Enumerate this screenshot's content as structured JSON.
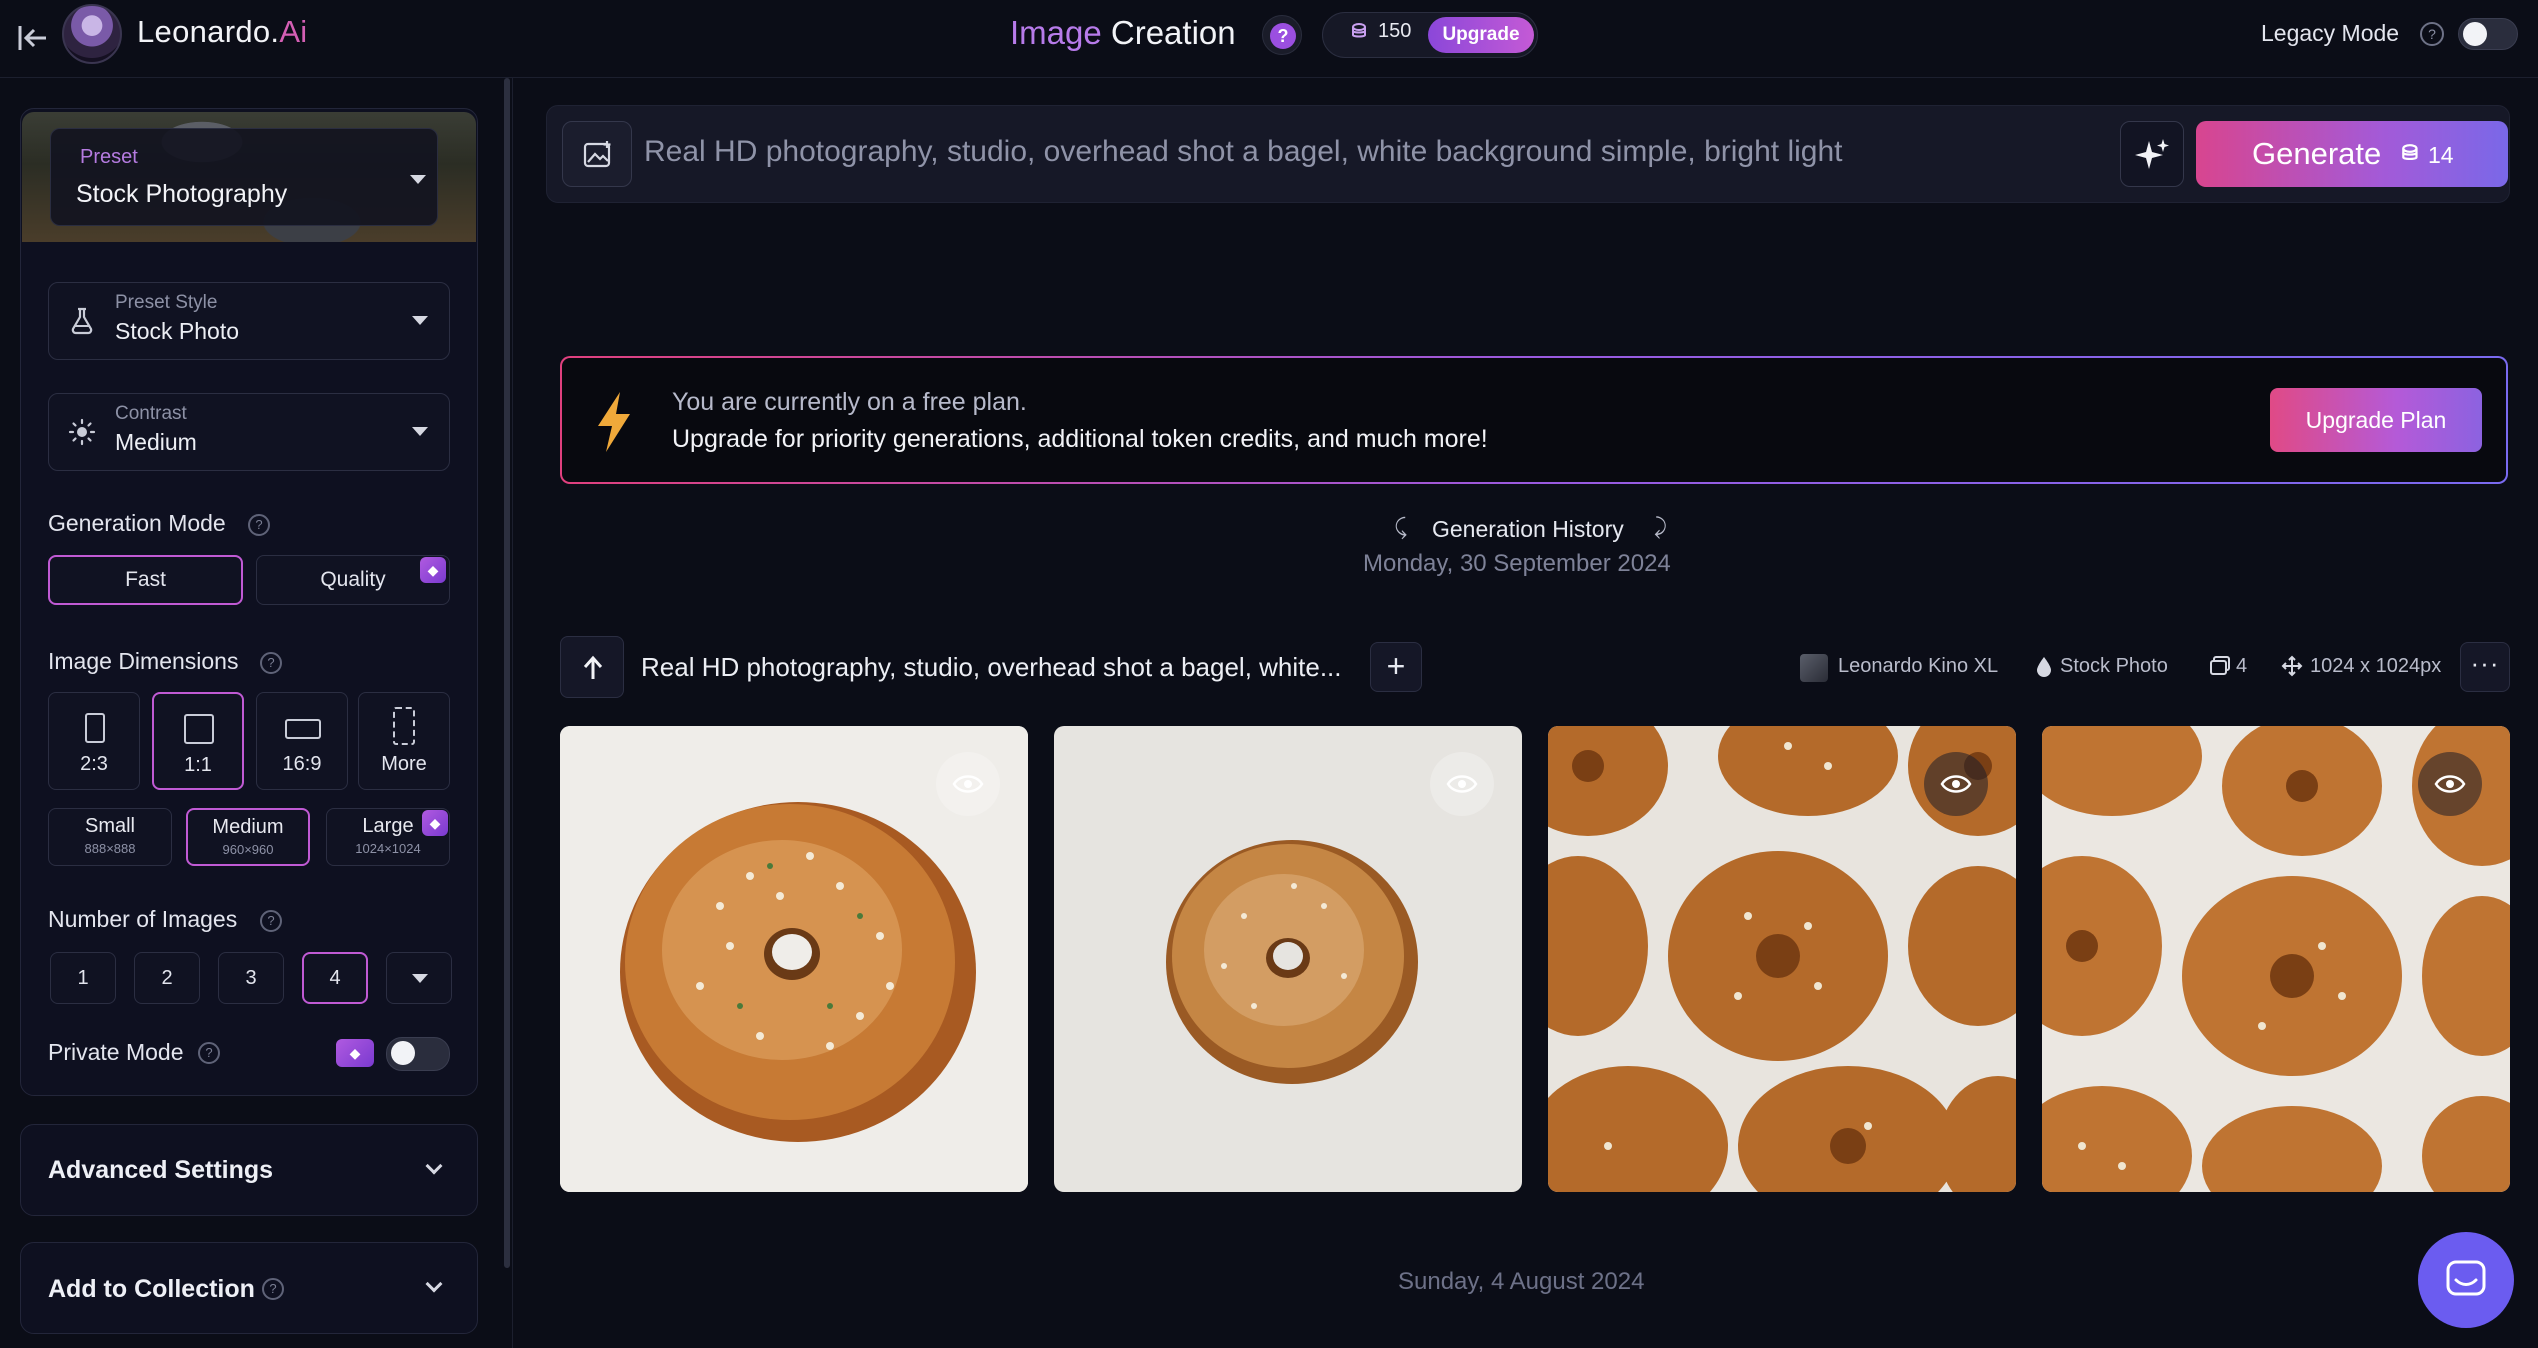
{
  "header": {
    "brand_name": "Leonardo.",
    "brand_suffix": "Ai",
    "title_highlight": "Image",
    "title_rest": " Creation",
    "help_symbol": "?",
    "tokens": "150",
    "upgrade_label": "Upgrade",
    "legacy_mode_label": "Legacy Mode",
    "legacy_help_symbol": "?"
  },
  "sidebar": {
    "preset": {
      "label": "Preset",
      "value": "Stock Photography"
    },
    "preset_style": {
      "label": "Preset Style",
      "value": "Stock Photo"
    },
    "contrast": {
      "label": "Contrast",
      "value": "Medium"
    },
    "generation_mode": {
      "label": "Generation Mode",
      "options": [
        "Fast",
        "Quality"
      ],
      "selected": "Fast"
    },
    "image_dimensions": {
      "label": "Image Dimensions",
      "ratios": [
        "2:3",
        "1:1",
        "16:9",
        "More"
      ],
      "selected_ratio": "1:1",
      "sizes": [
        {
          "name": "Small",
          "dims": "888×888"
        },
        {
          "name": "Medium",
          "dims": "960×960"
        },
        {
          "name": "Large",
          "dims": "1024×1024"
        }
      ],
      "selected_size": "Medium"
    },
    "number_of_images": {
      "label": "Number of Images",
      "options": [
        "1",
        "2",
        "3",
        "4"
      ],
      "selected": "4"
    },
    "private_mode_label": "Private Mode",
    "advanced_settings_label": "Advanced Settings",
    "add_to_collection_label": "Add to Collection"
  },
  "prompt": {
    "text": "Real HD photography, studio, overhead shot a bagel, white background simple, bright light",
    "generate_label": "Generate",
    "generate_cost": "14"
  },
  "promo": {
    "line1": "You are currently on a free plan.",
    "line2": "Upgrade for priority generations, additional token credits, and much more!",
    "button_label": "Upgrade Plan"
  },
  "history": {
    "title": "Generation History",
    "date": "Monday, 30 September 2024",
    "older_date": "Sunday, 4 August 2024",
    "generation": {
      "prompt": "Real HD photography, studio, overhead shot a bagel, white...",
      "model": "Leonardo Kino XL",
      "style": "Stock Photo",
      "image_count": "4",
      "dimensions": "1024 x 1024px"
    }
  },
  "colors": {
    "accent_pink": "#d8458f",
    "accent_purple": "#9b4fe0",
    "selected_border": "#c05ad4",
    "background": "#0b0d17"
  },
  "icons": [
    "back-arrow-icon",
    "image-prompt-icon",
    "magic-sparkle-icon",
    "coins-icon",
    "bolt-icon",
    "eye-icon",
    "flask-icon",
    "sun-icon",
    "gem-icon",
    "chat-icon"
  ]
}
